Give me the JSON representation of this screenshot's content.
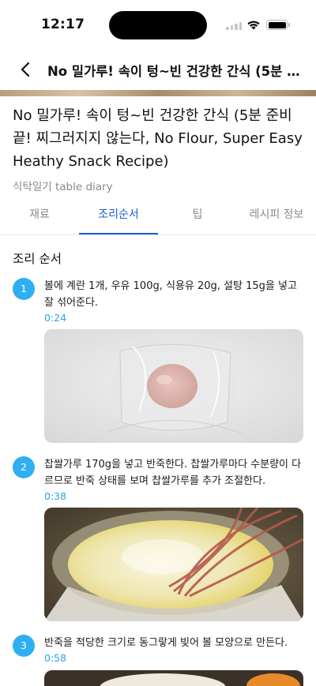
{
  "status_bar": {
    "time": "12:17"
  },
  "nav": {
    "title": "No 밀가루! 속이 텅~빈 건강한 간식 (5분 준비..."
  },
  "recipe": {
    "title": "No 밀가루! 속이 텅~빈 건강한 간식 (5분 준비 끝! 찌그러지지 않는다, No Flour, Super Easy Heathy Snack Recipe)",
    "channel": "식탁일기 table diary"
  },
  "tabs": [
    {
      "label": "재료"
    },
    {
      "label": "조리순서"
    },
    {
      "label": "팁"
    },
    {
      "label": "레시피 정보"
    }
  ],
  "active_tab": "조리순서",
  "section_title": "조리 순서",
  "steps": [
    {
      "num": "1",
      "text": "볼에 계란 1개, 우유 100g, 식용유 20g, 설탕 15g을 넣고 잘 섞어준다.",
      "time": "0:24"
    },
    {
      "num": "2",
      "text": "찹쌀가루 170g을 넣고 반죽한다. 찹쌀가루마다 수분량이 다르므로 반죽 상태를 보며 찹쌀가루를 추가 조절한다.",
      "time": "0:38"
    },
    {
      "num": "3",
      "text": "반죽을 적당한 크기로 동그랗게 빚어 볼 모양으로 만든다.",
      "time": "0:58"
    }
  ],
  "colors": {
    "accent_blue": "#1a5fd6",
    "step_badge": "#2eaff2",
    "timestamp": "#2aa2e6"
  }
}
